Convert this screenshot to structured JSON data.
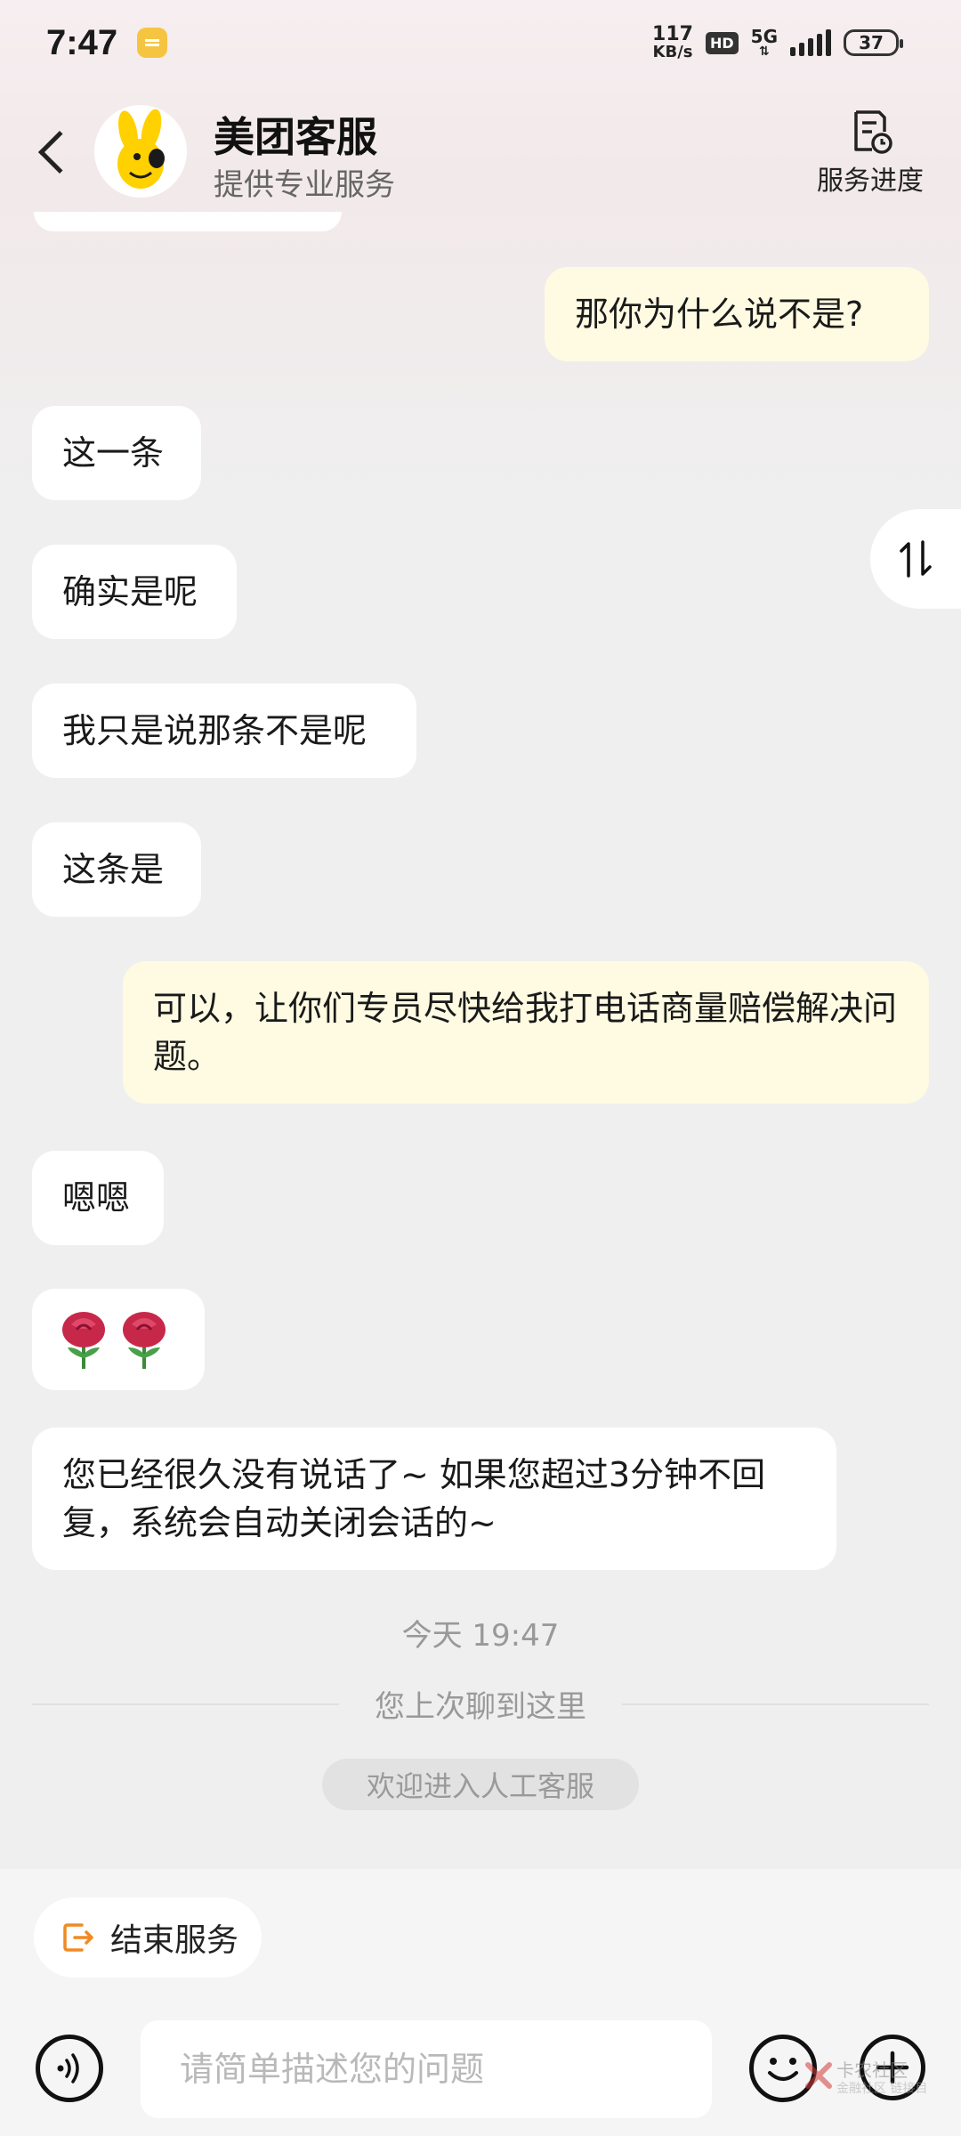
{
  "status_bar": {
    "time": "7:47",
    "net_speed_value": "117",
    "net_speed_unit": "KB/s",
    "hd": "HD",
    "network": "5G",
    "battery": "37"
  },
  "header": {
    "back_icon": "chevron-left-icon",
    "title": "美团客服",
    "subtitle": "提供专业服务",
    "progress_label": "服务进度"
  },
  "messages": [
    {
      "side": "out",
      "text": "那你为什么说不是?"
    },
    {
      "side": "in",
      "text": "这一条"
    },
    {
      "side": "in",
      "text": "确实是呢"
    },
    {
      "side": "in",
      "text": "我只是说那条不是呢"
    },
    {
      "side": "in",
      "text": "这条是"
    },
    {
      "side": "out",
      "text": "可以，让你们专员尽快给我打电话商量赔偿解决问题。"
    },
    {
      "side": "in",
      "text": "嗯嗯"
    },
    {
      "side": "in",
      "text": "rose-emoji x2"
    },
    {
      "side": "in",
      "text": "您已经很久没有说话了~ 如果您超过3分钟不回复，系统会自动关闭会话的~"
    }
  ],
  "timestamp": "今天 19:47",
  "last_read_divider": "您上次聊到这里",
  "welcome_notice": "欢迎进入人工客服",
  "end_service_label": "结束服务",
  "input": {
    "placeholder": "请简单描述您的问题"
  },
  "watermark": {
    "line1": "卡农社区",
    "line2": "金融社区 链接目"
  },
  "colors": {
    "outgoing_bubble": "#fefbe2",
    "incoming_bubble": "#ffffff",
    "accent_orange": "#f08a24",
    "background": "#efefef"
  }
}
